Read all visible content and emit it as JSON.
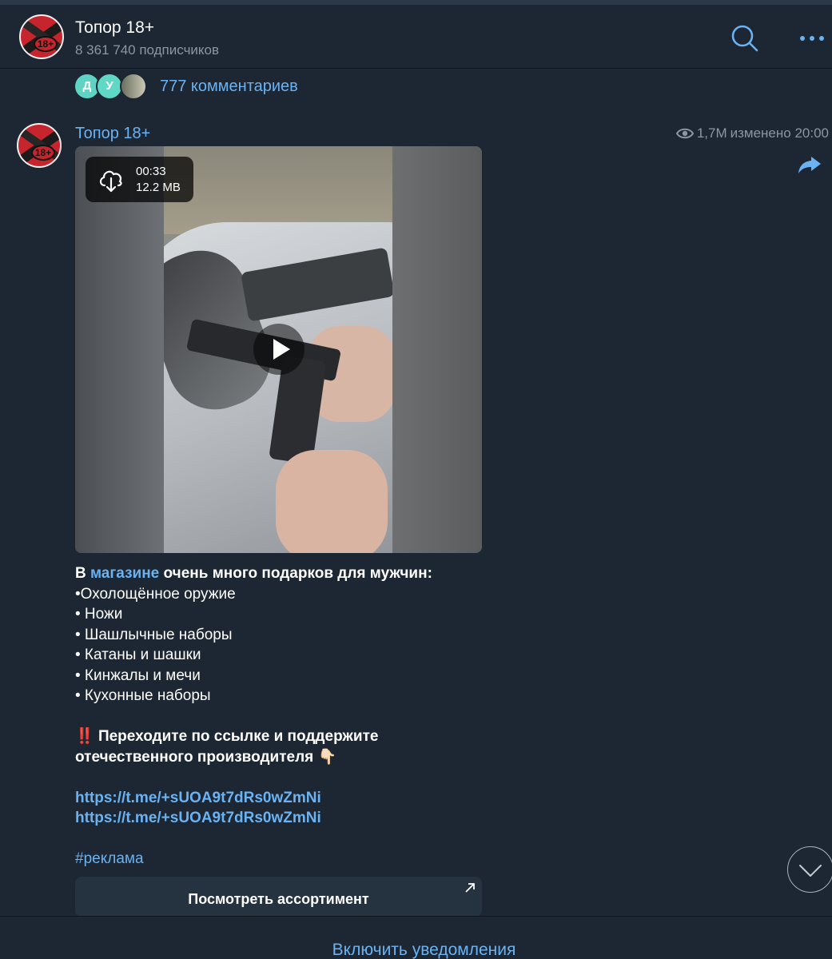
{
  "header": {
    "title": "Топор 18+",
    "subscribers": "8 361 740 подписчиков",
    "avatar_text": "18+"
  },
  "comments": {
    "avatars": [
      "Д",
      "У",
      ""
    ],
    "label": "777 комментариев"
  },
  "post": {
    "author": "Топор 18+",
    "avatar_text": "18+",
    "views": "1,7M",
    "edited": "изменено 20:00",
    "media": {
      "duration": "00:33",
      "size": "12.2 MB"
    },
    "text": {
      "intro_prefix": "В ",
      "intro_link": "магазине",
      "intro_suffix": " очень много подарков для мужчин:",
      "items": [
        "•Охолощённое оружие",
        "• Ножи",
        "• Шашлычные наборы",
        "• Катаны и шашки",
        "• Кинжалы и мечи",
        "• Кухонные наборы"
      ],
      "call_emoji": "‼️",
      "call_line1": "Переходите по ссылке и поддержите",
      "call_line2": "отечественного производителя",
      "call_emoji2": "👇🏻",
      "links": [
        "https://t.me/+sUOA9t7dRs0wZmNi",
        "https://t.me/+sUOA9t7dRs0wZmNi"
      ],
      "hashtag": "#реклама"
    },
    "button_label": "Посмотреть ассортимент"
  },
  "footer": {
    "notify_label": "Включить уведомления"
  },
  "colors": {
    "background": "#1c2733",
    "accent": "#6ab2f2",
    "muted": "#8b96a2"
  }
}
